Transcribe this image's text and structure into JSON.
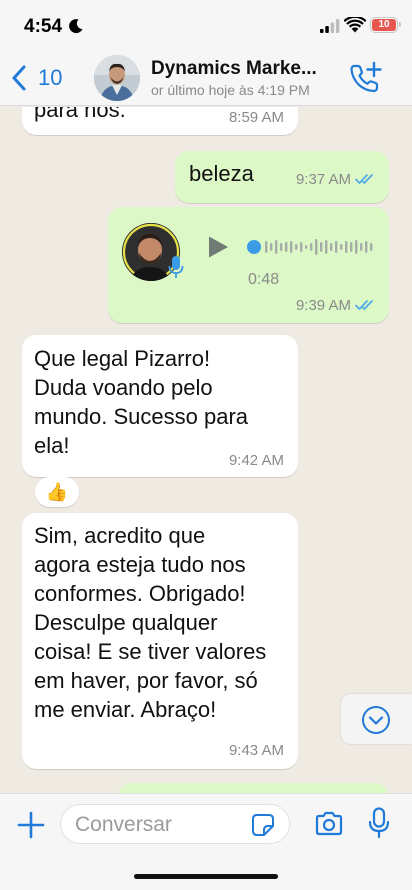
{
  "status_bar": {
    "time": "4:54",
    "battery_level": "10"
  },
  "header": {
    "back_count": "10",
    "contact_name": "Dynamics Marke...",
    "last_seen": "or último hoje às 4:19 PM"
  },
  "messages": [
    {
      "direction": "in",
      "text": "para nós.",
      "time": "8:59 AM"
    },
    {
      "direction": "out",
      "text": "beleza",
      "time": "9:37 AM",
      "read": true
    },
    {
      "direction": "out",
      "type": "voice",
      "duration": "0:48",
      "time": "9:39 AM",
      "read": true
    },
    {
      "direction": "in",
      "text": "Que legal Pizarro!\nDuda voando pelo\nmundo. Sucesso para\nela!",
      "time": "9:42 AM",
      "reaction": "👍"
    },
    {
      "direction": "in",
      "text": "Sim, acredito que\nagora esteja tudo nos\nconformes. Obrigado!\nDesculpe qualquer\ncoisa! E se tiver valores\nem haver, por favor, só\nme enviar. Abraço!",
      "time": "9:43 AM"
    }
  ],
  "input": {
    "placeholder": "Conversar"
  },
  "colors": {
    "accent": "#1f7ad8",
    "outgoing_bubble": "#dbf8c6",
    "incoming_bubble": "#ffffff",
    "chat_background": "#efeae2",
    "read_ticks": "#4fa9e6"
  },
  "icons": {
    "status": [
      "moon-icon",
      "signal-icon",
      "wifi-icon",
      "battery-icon"
    ],
    "header": [
      "chevron-left-icon",
      "phone-add-icon"
    ],
    "input": [
      "plus-icon",
      "sticker-icon",
      "camera-icon",
      "microphone-icon"
    ],
    "chat": [
      "play-icon",
      "double-check-icon",
      "chevron-down-icon"
    ]
  }
}
